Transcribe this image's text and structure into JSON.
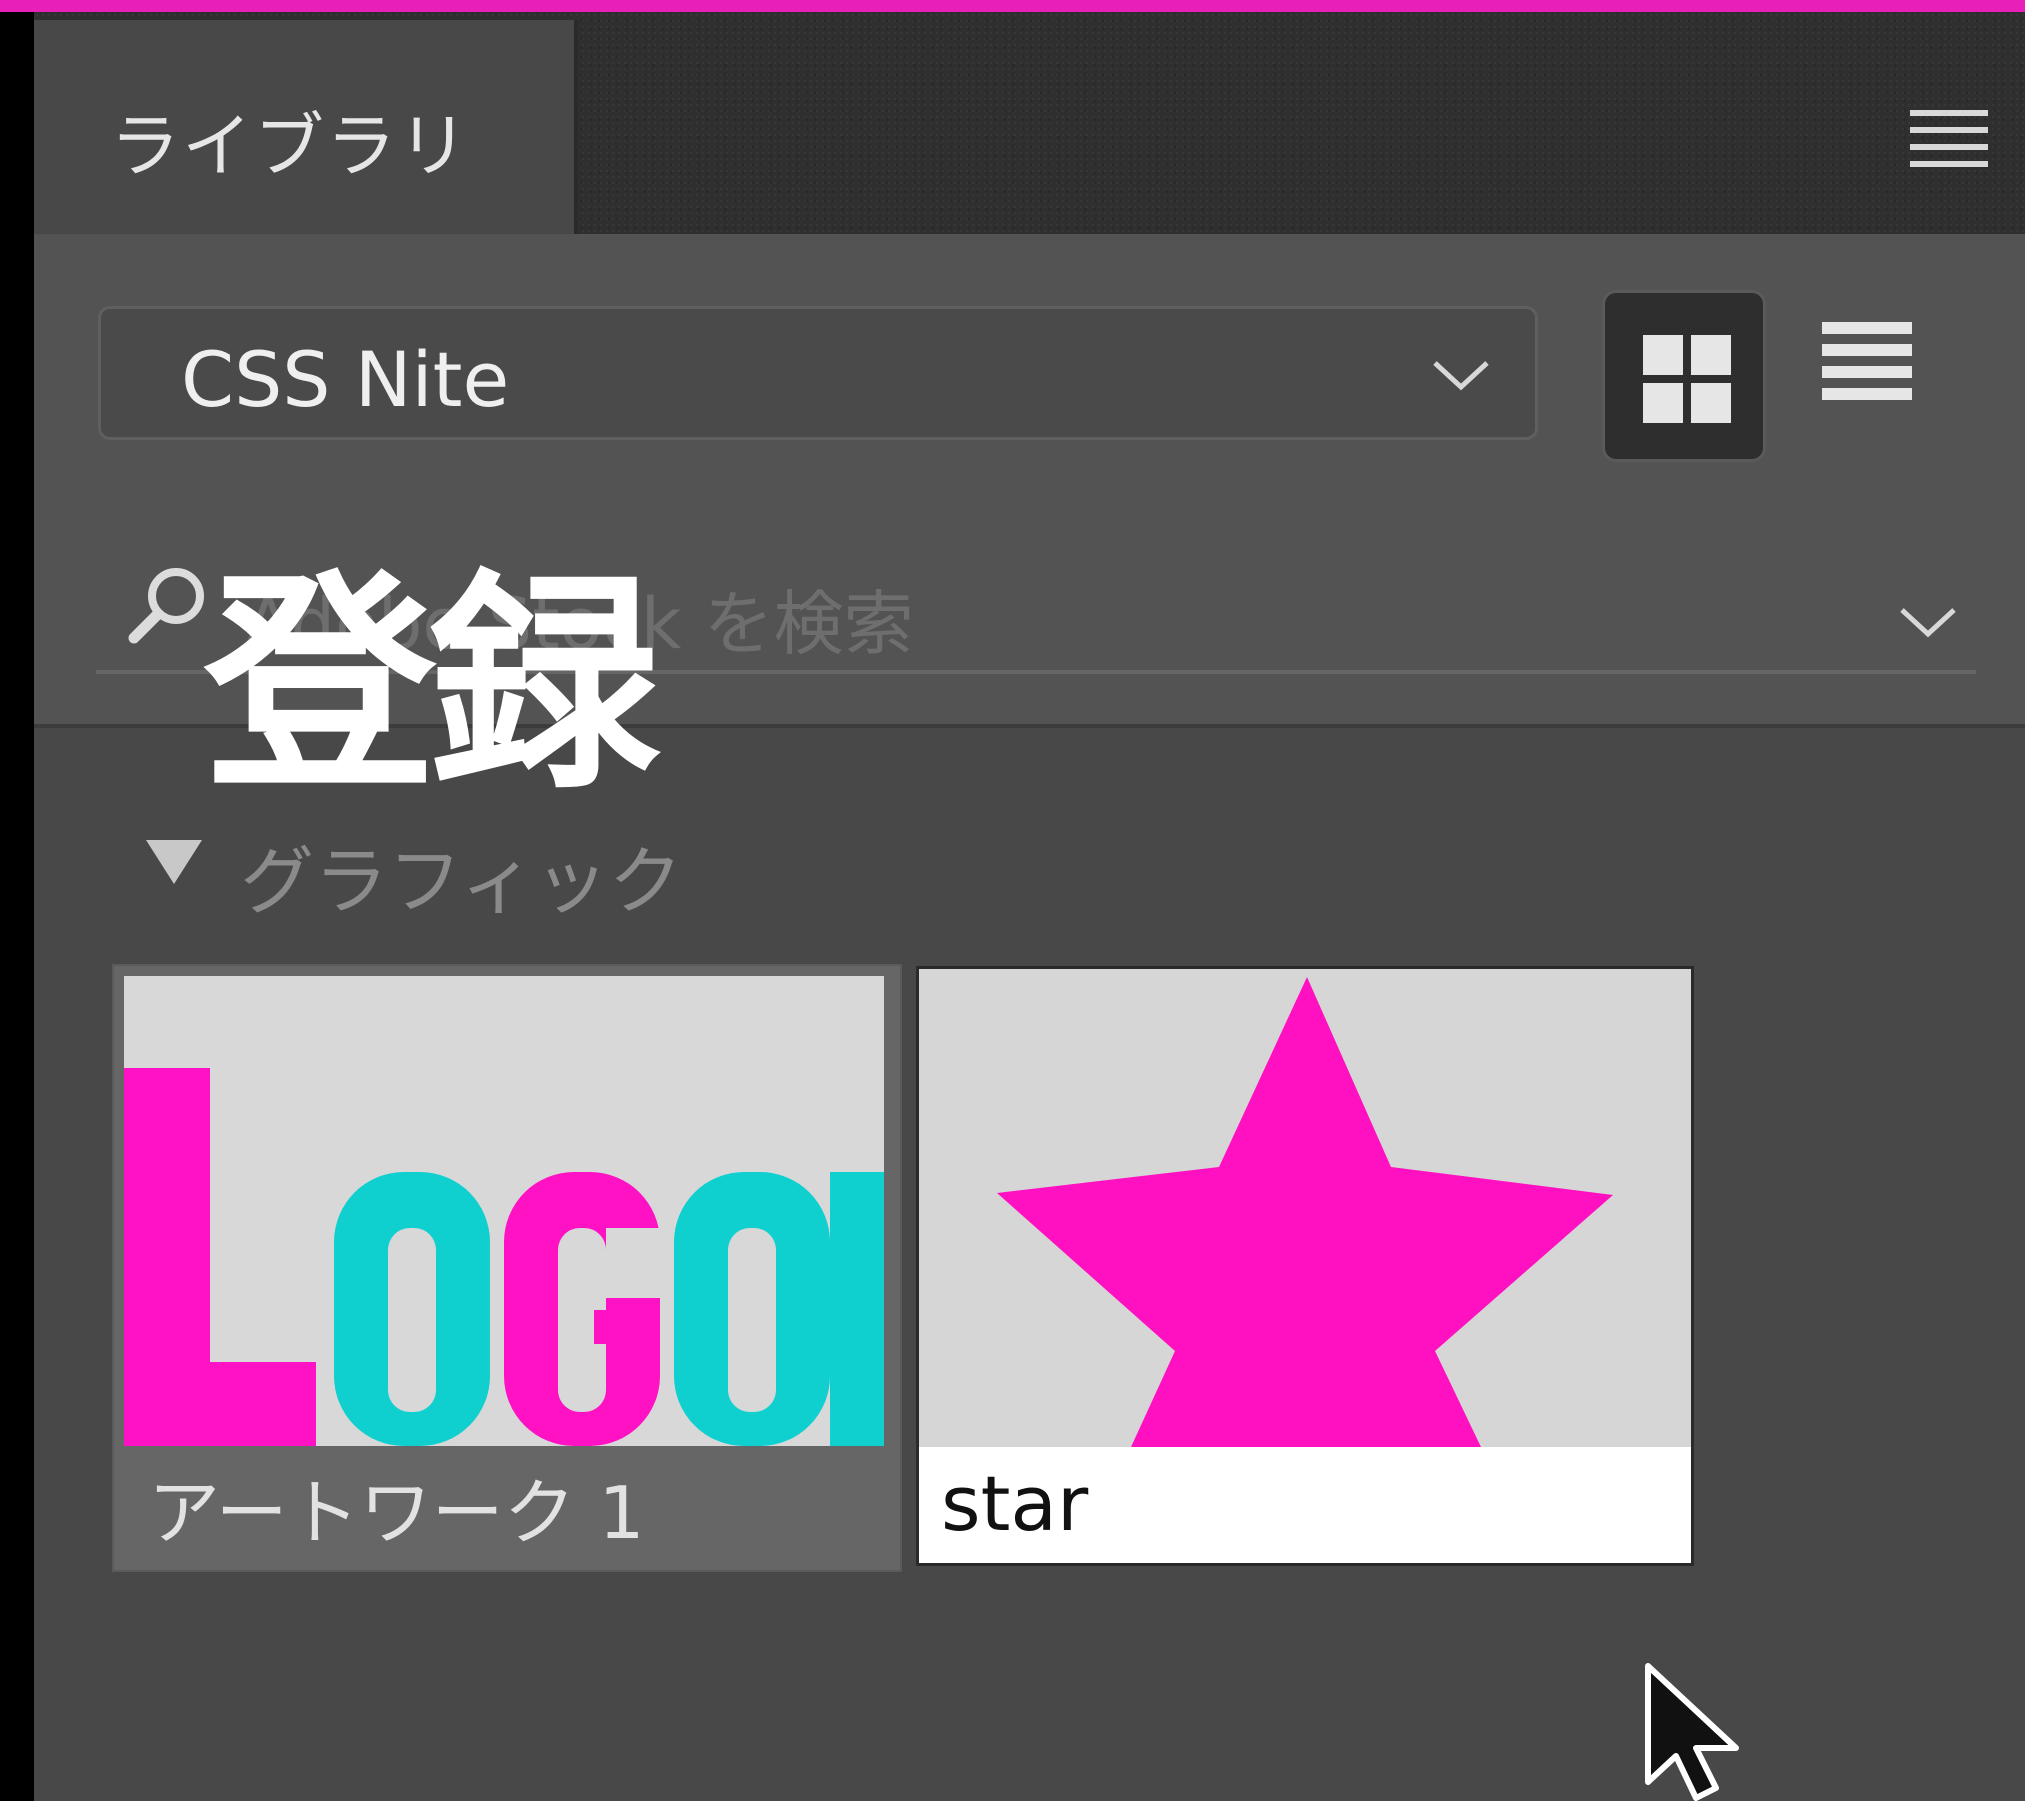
{
  "colors": {
    "accent": "#e81fb8",
    "panel_bg": "#484848",
    "logo_magenta": "#ff12c4",
    "logo_cyan": "#0fcfcf",
    "star_magenta": "#ff10c0"
  },
  "panel": {
    "tab_label": "ライブラリ",
    "menu_icon": "hamburger-menu-icon"
  },
  "library_select": {
    "value": "CSS Nite",
    "icon": "chevron-down-icon"
  },
  "view_toggle": {
    "grid_icon": "grid-view-icon",
    "list_icon": "list-view-icon",
    "selected": "grid"
  },
  "search": {
    "placeholder": "Adobe Stock を検索",
    "icon": "search-icon",
    "dropdown_icon": "chevron-down-icon"
  },
  "overlay": {
    "caption": "登録"
  },
  "section": {
    "label": "グラフィック",
    "expanded": true
  },
  "assets": [
    {
      "name": "アートワーク 1",
      "thumbnail_text": "LOGO",
      "selected": true
    },
    {
      "name": "star",
      "thumbnail_icon": "star-icon",
      "selected": false
    }
  ]
}
